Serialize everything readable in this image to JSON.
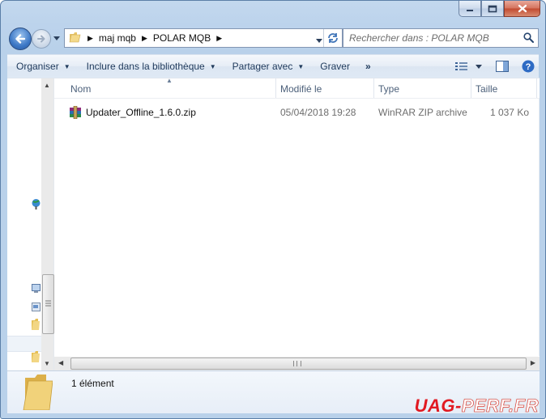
{
  "breadcrumb": [
    "maj mqb",
    "POLAR MQB"
  ],
  "search": {
    "placeholder": "Rechercher dans : POLAR MQB"
  },
  "toolbar": {
    "organize": "Organiser",
    "include": "Inclure dans la bibliothèque",
    "share": "Partager avec",
    "burn": "Graver",
    "more": "»"
  },
  "columns": {
    "name": "Nom",
    "modified": "Modifié le",
    "type": "Type",
    "size": "Taille"
  },
  "files": [
    {
      "name": "Updater_Offline_1.6.0.zip",
      "modified": "05/04/2018 19:28",
      "type": "WinRAR ZIP archive",
      "size": "1 037 Ko",
      "icon": "winrar-archive-icon"
    }
  ],
  "details": {
    "count": "1 élément"
  },
  "watermark": {
    "part1": "UAG-",
    "part2": "PERF.FR"
  },
  "colors": {
    "accent": "#2a5aa0",
    "frame": "#b9d1ea",
    "watermark_red": "#e11a22"
  }
}
